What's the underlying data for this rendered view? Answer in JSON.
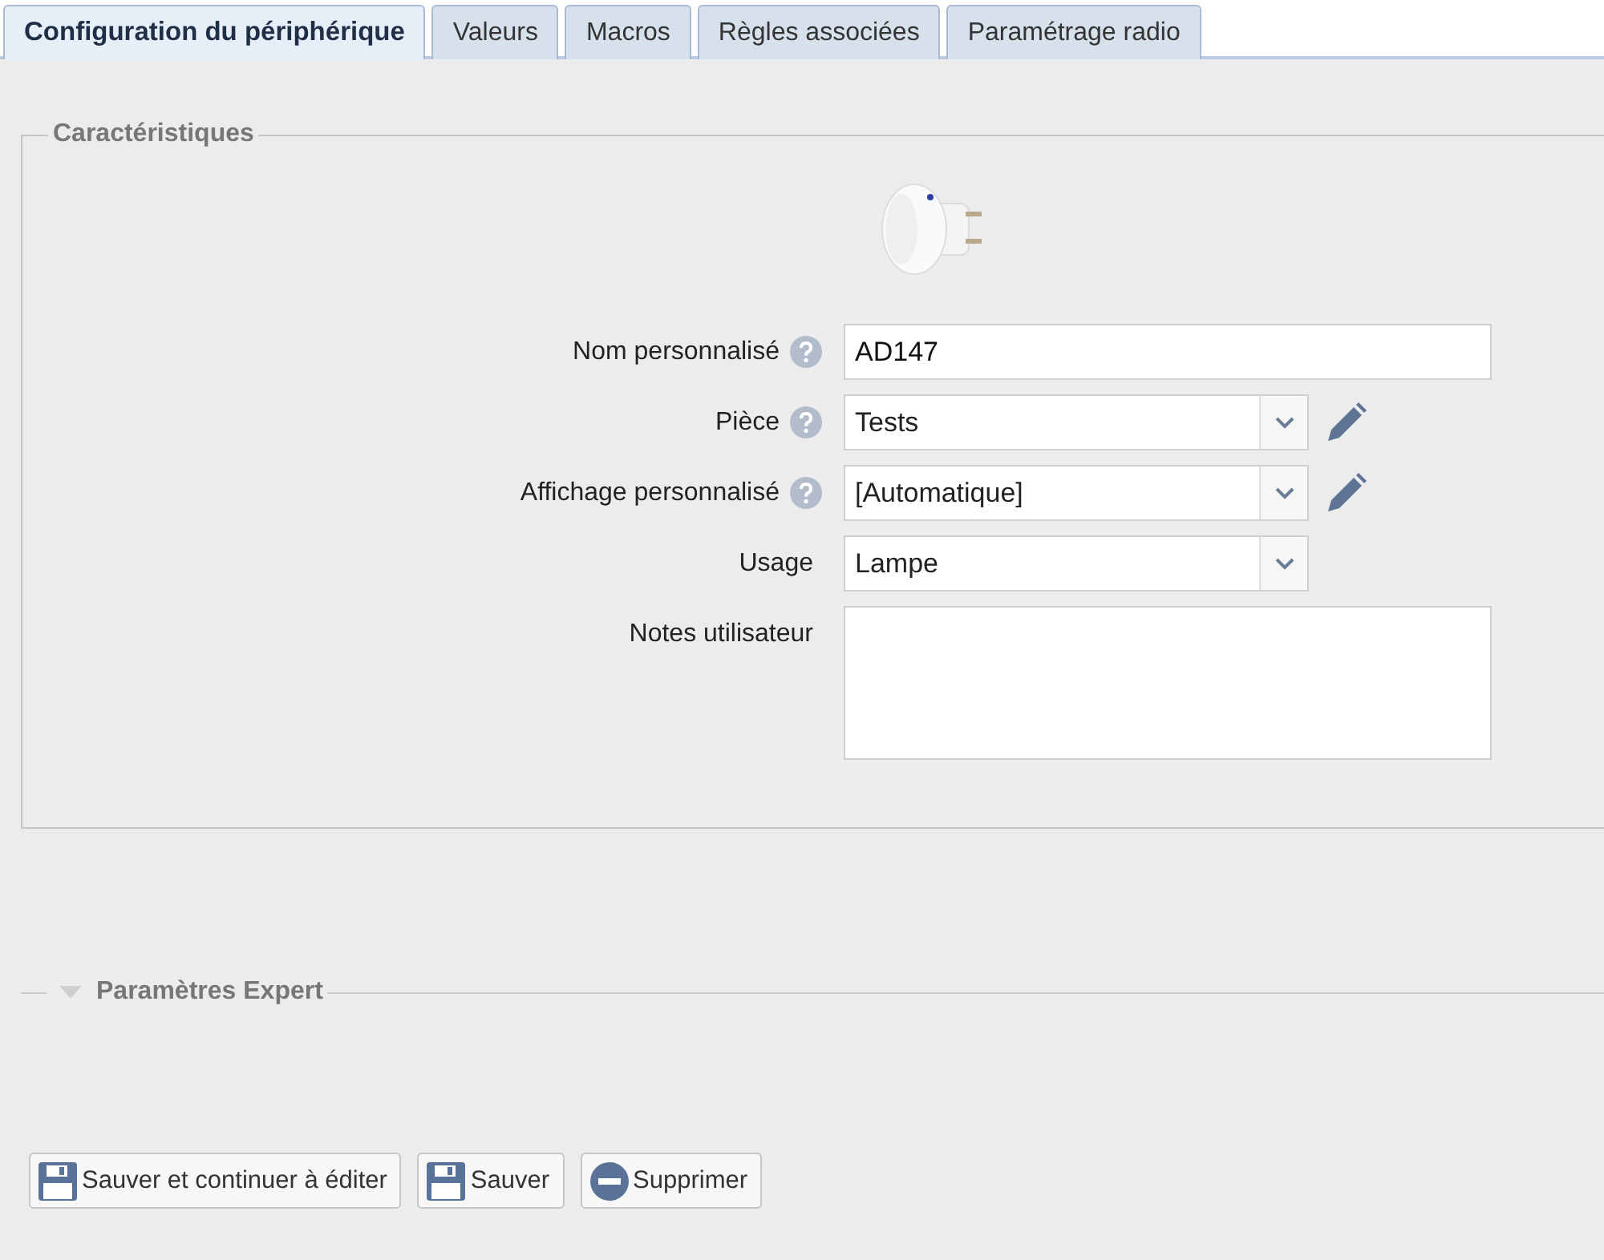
{
  "tabs": [
    {
      "label": "Configuration du périphérique",
      "selected": true
    },
    {
      "label": "Valeurs",
      "selected": false
    },
    {
      "label": "Macros",
      "selected": false
    },
    {
      "label": "Règles associées",
      "selected": false
    },
    {
      "label": "Paramétrage radio",
      "selected": false
    }
  ],
  "characteristics": {
    "legend": "Caractéristiques",
    "fields": [
      {
        "kind": "text",
        "label": "Nom personnalisé",
        "help": true,
        "value": "AD147"
      },
      {
        "kind": "select",
        "label": "Pièce",
        "help": true,
        "value": "Tests",
        "editable": true
      },
      {
        "kind": "select",
        "label": "Affichage personnalisé",
        "help": true,
        "value": "[Automatique]",
        "editable": true
      },
      {
        "kind": "select",
        "label": "Usage",
        "help": false,
        "value": "Lampe",
        "editable": false
      },
      {
        "kind": "textarea",
        "label": "Notes utilisateur",
        "help": false
      }
    ]
  },
  "expert": {
    "legend": "Paramètres Expert",
    "expanded": false
  },
  "buttons": [
    {
      "kind": "save",
      "label": "Sauver et continuer à éditer"
    },
    {
      "kind": "save",
      "label": "Sauver"
    },
    {
      "kind": "delete",
      "label": "Supprimer"
    }
  ]
}
